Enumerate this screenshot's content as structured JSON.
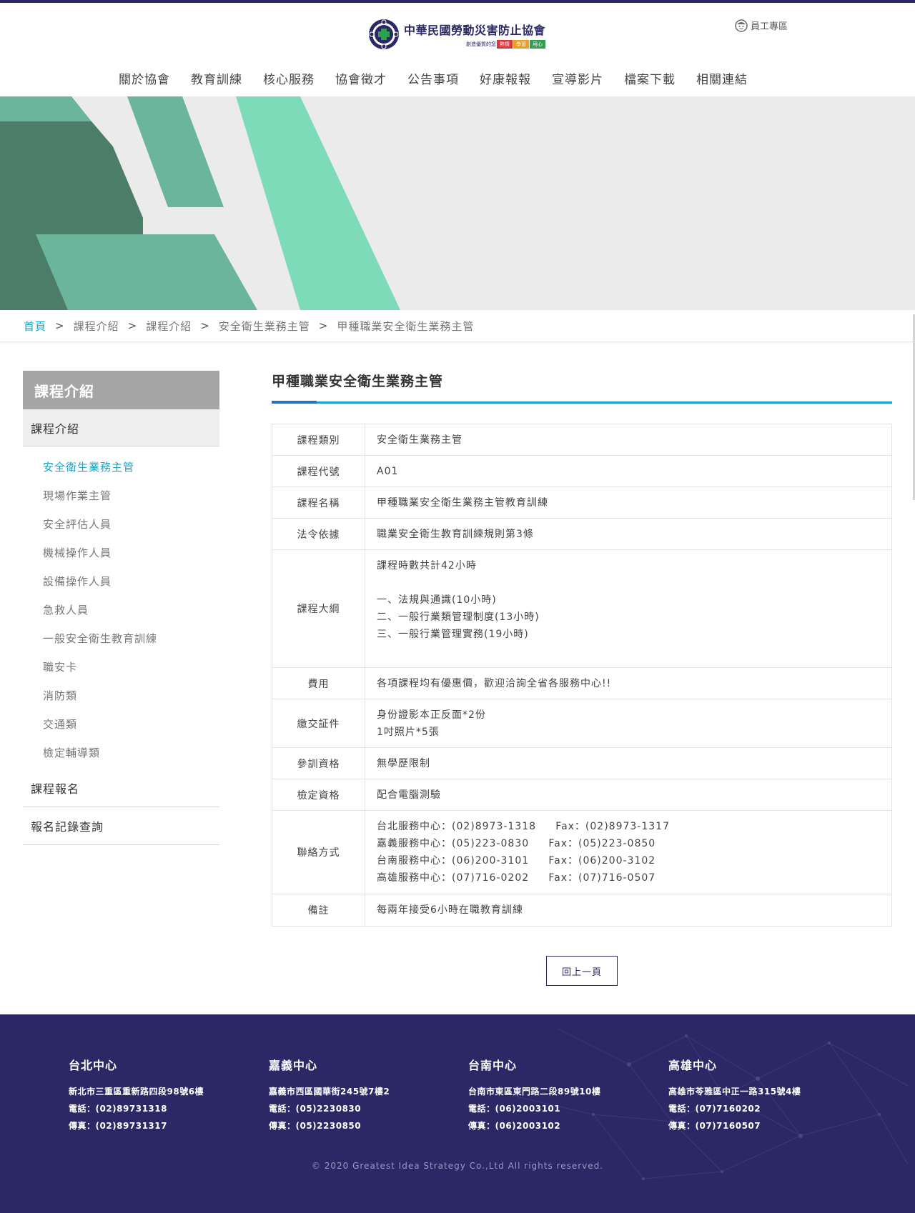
{
  "header": {
    "org_name": "中華民國勞動災害防止協會",
    "tagline": "創造優質的您",
    "keywords": [
      "熱情",
      "學習",
      "用心"
    ],
    "staff_link": "員工專區",
    "nav": [
      "關於協會",
      "教育訓練",
      "核心服務",
      "協會徵才",
      "公告事項",
      "好康報報",
      "宣導影片",
      "檔案下載",
      "相關連結"
    ]
  },
  "breadcrumb": [
    "首頁",
    "課程介紹",
    "課程介紹",
    "安全衛生業務主管",
    "甲種職業安全衛生業務主管"
  ],
  "breadcrumb_sep": ">",
  "sidebar": {
    "heading": "課程介紹",
    "category": "課程介紹",
    "items": [
      "安全衛生業務主管",
      "現場作業主管",
      "安全評估人員",
      "機械操作人員",
      "設備操作人員",
      "急救人員",
      "一般安全衛生教育訓練",
      "職安卡",
      "消防類",
      "交通類",
      "檢定輔導類"
    ],
    "links": [
      "課程報名",
      "報名記錄查詢"
    ]
  },
  "main": {
    "title": "甲種職業安全衛生業務主管",
    "rows": [
      {
        "label": "課程類別",
        "lines": [
          "安全衛生業務主管"
        ]
      },
      {
        "label": "課程代號",
        "lines": [
          "A01"
        ]
      },
      {
        "label": "課程名稱",
        "lines": [
          "甲種職業安全衛生業務主管教育訓練"
        ]
      },
      {
        "label": "法令依據",
        "lines": [
          "職業安全衛生教育訓練規則第3條"
        ]
      },
      {
        "label": "課程大綱",
        "lines": [
          "課程時數共計42小時",
          "",
          "一、法規與通識(10小時)",
          "二、一般行業類管理制度(13小時)",
          "三、一般行業管理實務(19小時)",
          ""
        ]
      },
      {
        "label": "費用",
        "lines": [
          "各項課程均有優惠價，歡迎洽詢全省各服務中心!!"
        ]
      },
      {
        "label": "繳交証件",
        "lines": [
          "身份證影本正反面*2份",
          "1吋照片*5張"
        ]
      },
      {
        "label": "參訓資格",
        "lines": [
          "無學歷限制"
        ]
      },
      {
        "label": "檢定資格",
        "lines": [
          "配合電腦測驗"
        ]
      },
      {
        "label": "聯絡方式",
        "lines": [
          "台北服務中心：(02)8973-1318     Fax：(02)8973-1317",
          "嘉義服務中心：(05)223-0830     Fax：(05)223-0850",
          "台南服務中心：(06)200-3101     Fax：(06)200-3102",
          "高雄服務中心：(07)716-0202     Fax：(07)716-0507"
        ]
      },
      {
        "label": "備註",
        "lines": [
          "每兩年接受6小時在職教育訓練"
        ]
      }
    ],
    "back_button": "回上一頁"
  },
  "footer": {
    "centers": [
      {
        "name": "台北中心",
        "address": "新北市三重區重新路四段98號6樓",
        "phone": "電話：(02)89731318",
        "fax": "傳真：(02)89731317"
      },
      {
        "name": "嘉義中心",
        "address": "嘉義市西區國華街245號7樓2",
        "phone": "電話：(05)2230830",
        "fax": "傳真：(05)2230850"
      },
      {
        "name": "台南中心",
        "address": "台南市東區東門路二段89號10樓",
        "phone": "電話：(06)2003101",
        "fax": "傳真：(06)2003102"
      },
      {
        "name": "高雄中心",
        "address": "高雄市苓雅區中正一路315號4樓",
        "phone": "電話：(07)7160202",
        "fax": "傳真：(07)7160507"
      }
    ],
    "copyright": "© 2020 Greatest Idea Strategy Co.,Ltd All rights reserved."
  },
  "colors": {
    "brand": "#2c2765",
    "accent": "#1aa3c4",
    "banner_green": "#7edbb9",
    "banner_dark": "#4b7d69"
  },
  "icons": [
    "logo-emblem-icon",
    "staff-face-icon"
  ]
}
